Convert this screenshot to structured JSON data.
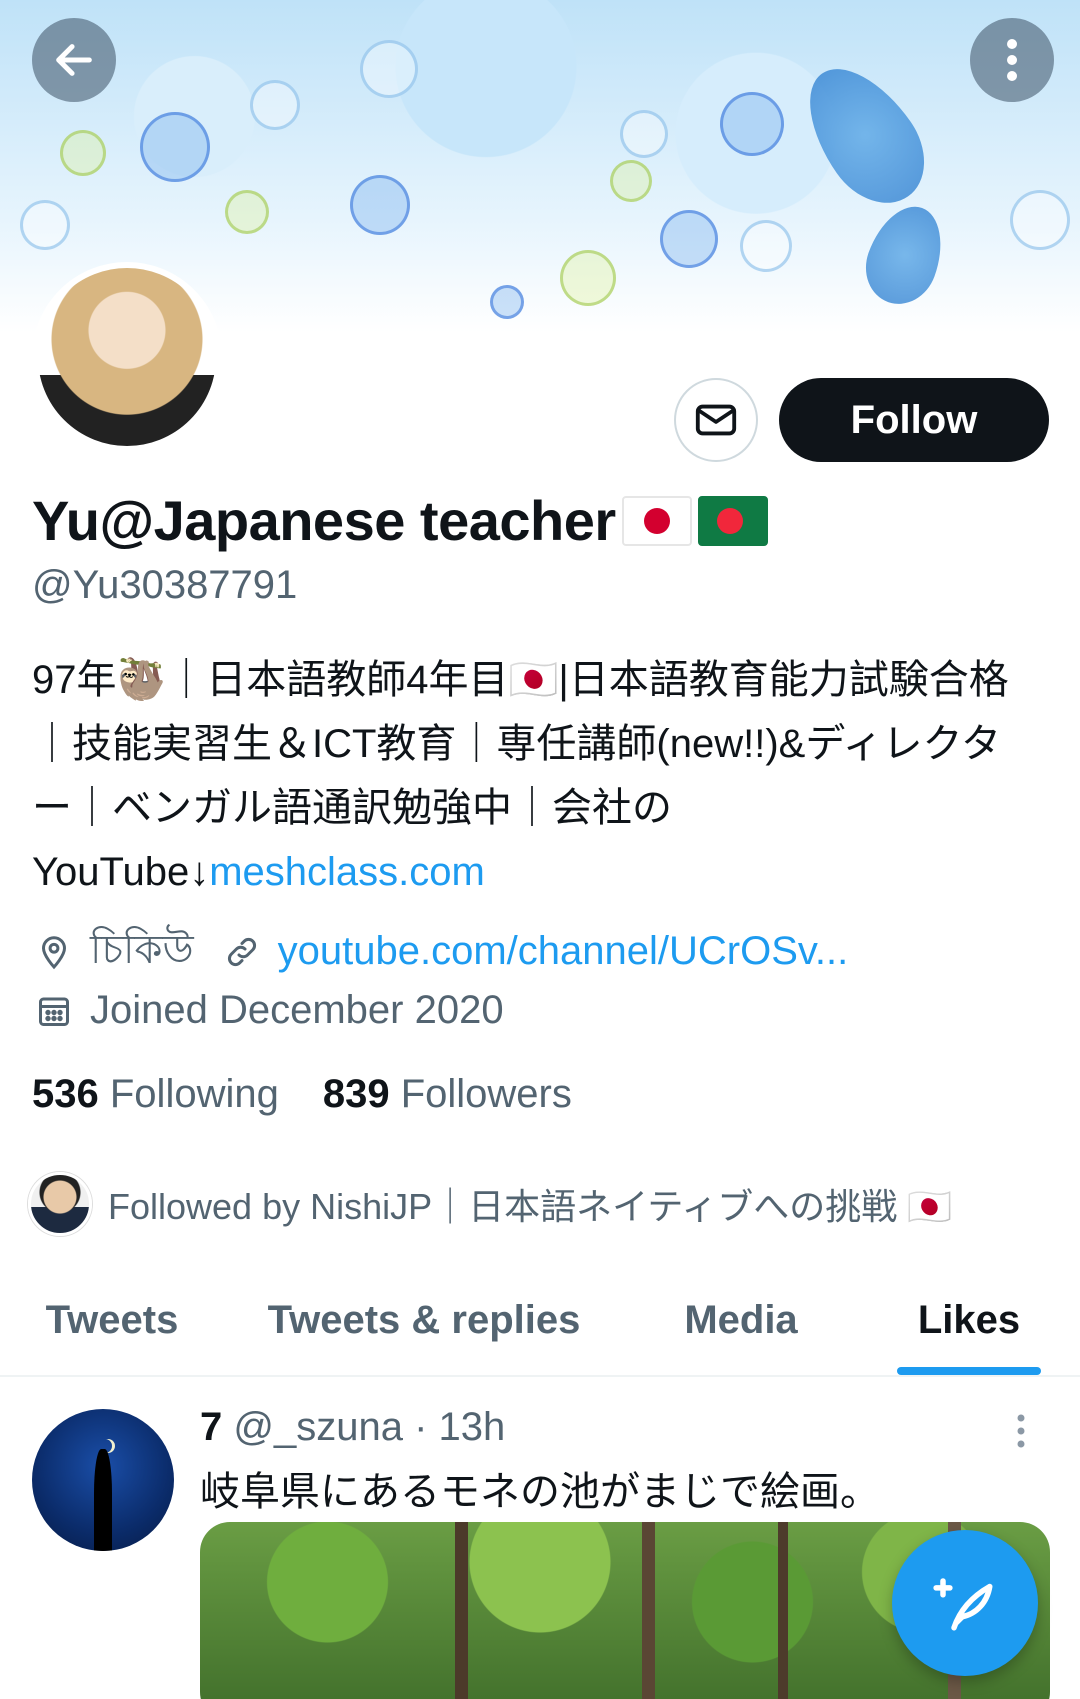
{
  "header": {
    "back_icon": "arrow-left-icon",
    "more_icon": "more-vertical-icon"
  },
  "profile": {
    "display_name": "Yu@Japanese teacher",
    "name_flags": [
      "flag-japan",
      "flag-bangladesh"
    ],
    "handle": "@Yu30387791",
    "bio_text": "97年🦥｜日本語教師4年目🇯🇵|日本語教育能力試験合格｜技能実習生＆ICT教育｜専任講師(new!!)&ディレクター｜ベンガル語通訳勉強中｜会社のYouTube↓",
    "bio_link": "meshclass.com",
    "location": "চিকিউ",
    "website": "youtube.com/channel/UCrOSv...",
    "joined": "Joined December 2020",
    "following_count": "536",
    "following_label": "Following",
    "followers_count": "839",
    "followers_label": "Followers",
    "followed_by": "Followed by NishiJP｜日本語ネイティブへの挑戦 🇯🇵"
  },
  "actions": {
    "message_icon": "envelope-icon",
    "follow_label": "Follow"
  },
  "tabs": [
    {
      "label": "Tweets",
      "active": false
    },
    {
      "label": "Tweets & replies",
      "active": false
    },
    {
      "label": "Media",
      "active": false
    },
    {
      "label": "Likes",
      "active": true
    }
  ],
  "tweet": {
    "author_name": "7",
    "author_handle": "@_szuna",
    "separator": "·",
    "time": "13h",
    "text": "岐阜県にあるモネの池がまじで絵画。"
  },
  "fab_icon": "compose-tweet-icon",
  "colors": {
    "accent": "#1d9bf0",
    "text_primary": "#0f1419",
    "text_secondary": "#536471",
    "follow_bg": "#0f1419"
  }
}
